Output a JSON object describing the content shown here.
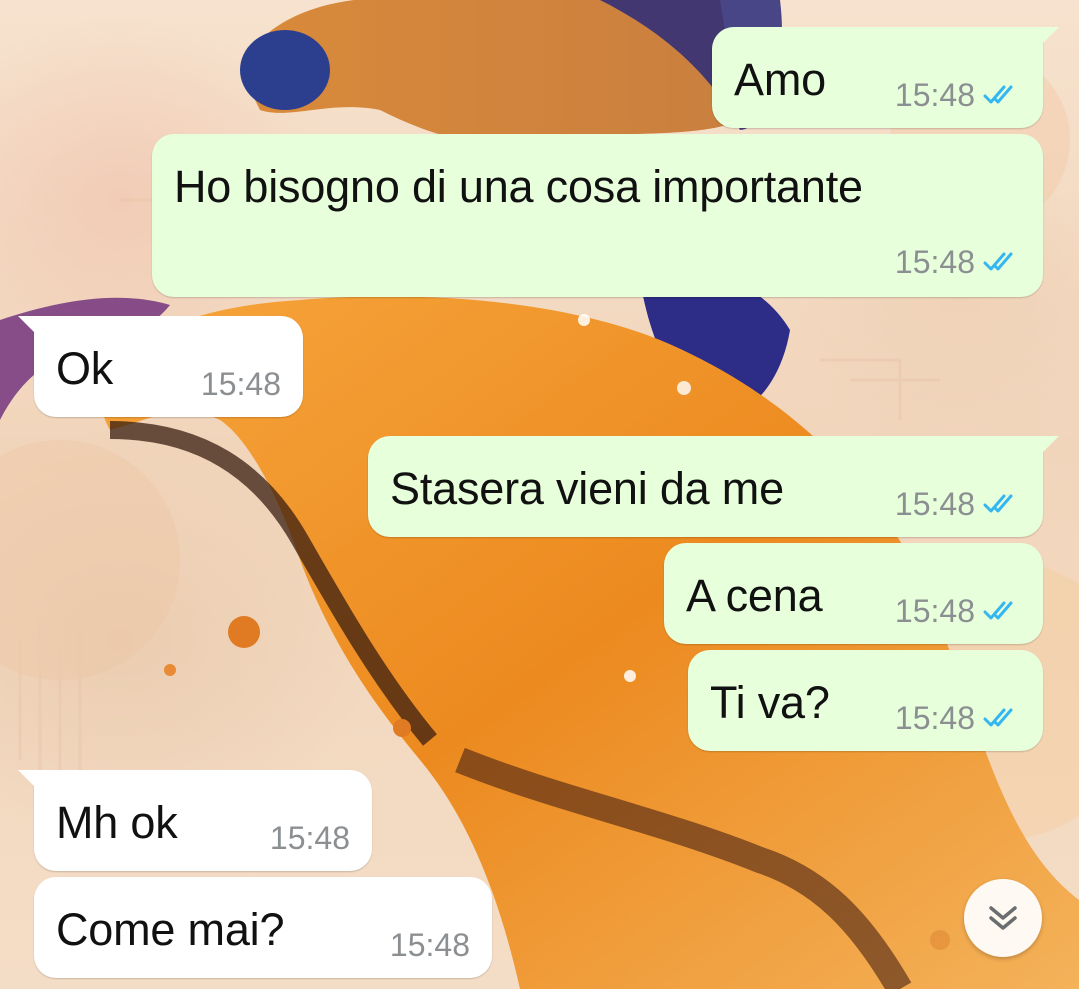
{
  "messages": [
    {
      "id": "m1",
      "direction": "outgoing",
      "text": "Amo",
      "time": "15:48",
      "status": "read"
    },
    {
      "id": "m2",
      "direction": "outgoing",
      "text": "Ho bisogno di una cosa importante",
      "time": "15:48",
      "status": "read"
    },
    {
      "id": "m3",
      "direction": "incoming",
      "text": "Ok",
      "time": "15:48"
    },
    {
      "id": "m4",
      "direction": "outgoing",
      "text": "Stasera vieni da me",
      "time": "15:48",
      "status": "read"
    },
    {
      "id": "m5",
      "direction": "outgoing",
      "text": "A cena",
      "time": "15:48",
      "status": "read"
    },
    {
      "id": "m6",
      "direction": "outgoing",
      "text": "Ti va?",
      "time": "15:48",
      "status": "read"
    },
    {
      "id": "m7",
      "direction": "incoming",
      "text": "Mh ok",
      "time": "15:48"
    },
    {
      "id": "m8",
      "direction": "incoming",
      "text": "Come mai?",
      "time": "15:48"
    }
  ],
  "icons": {
    "read_receipt": "double-check-icon",
    "scroll_down": "chevron-double-down-icon"
  },
  "colors": {
    "outgoing_bubble": "#e7ffdb",
    "incoming_bubble": "#ffffff",
    "read_ticks": "#34b7f1",
    "timestamp": "#8c8f92"
  }
}
